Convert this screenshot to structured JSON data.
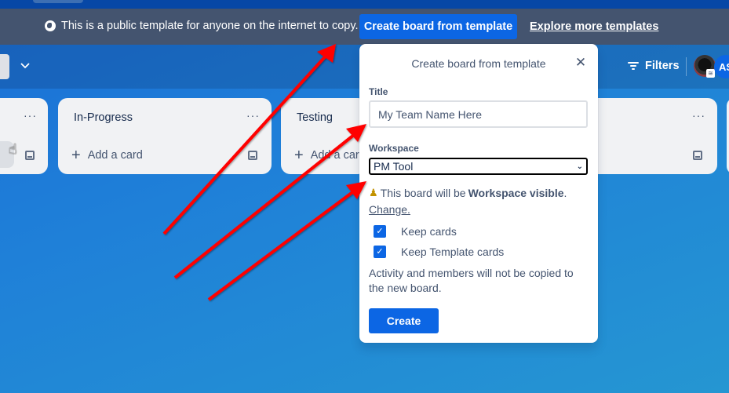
{
  "banner": {
    "icon": "globe-icon",
    "message": "This is a public template for anyone on the internet to copy.",
    "create_button": "Create board from template",
    "explore_link": "Explore more templates"
  },
  "boardbar": {
    "filters_label": "Filters",
    "avatar_initials": "AS"
  },
  "lists": [
    {
      "title": "",
      "add_label": ""
    },
    {
      "title": "In-Progress",
      "add_label": "Add a card"
    },
    {
      "title": "Testing",
      "add_label": "Add a card"
    },
    {
      "title": "",
      "add_label": ""
    }
  ],
  "modal": {
    "title": "Create board from template",
    "title_label": "Title",
    "title_value": "My Team Name Here",
    "workspace_label": "Workspace",
    "workspace_value": "PM Tool",
    "visibility_prefix": "This board will be",
    "visibility_value": "Workspace visible",
    "visibility_suffix": ".",
    "change_link": "Change.",
    "checkboxes": [
      {
        "label": "Keep cards",
        "checked": true
      },
      {
        "label": "Keep Template cards",
        "checked": true
      }
    ],
    "note": "Activity and members will not be copied to the new board.",
    "create_button": "Create"
  },
  "annotation_color": "#ff0000"
}
